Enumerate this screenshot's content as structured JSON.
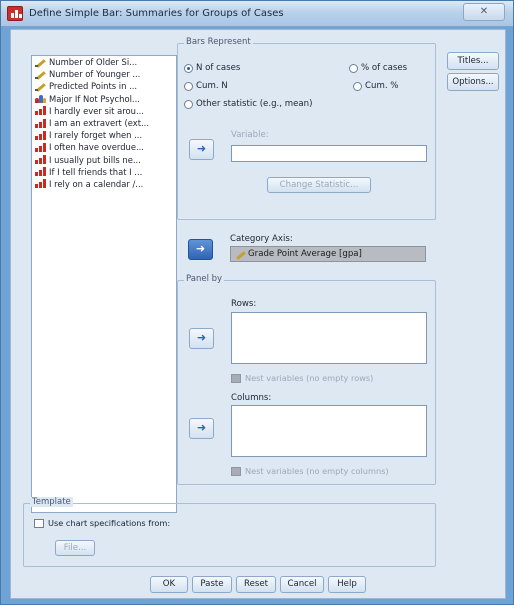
{
  "window": {
    "title": "Define Simple Bar: Summaries for Groups of Cases",
    "close_label": "✕"
  },
  "variables": [
    {
      "label": "Number of Older Si...",
      "icon": "scale-icon"
    },
    {
      "label": "Number of Younger ...",
      "icon": "scale-icon"
    },
    {
      "label": "Predicted Points in ...",
      "icon": "scale-icon"
    },
    {
      "label": "Major If Not Psychol...",
      "icon": "nominal-icon"
    },
    {
      "label": "I hardly ever sit arou...",
      "icon": "ordinal-icon"
    },
    {
      "label": "I am an extravert (ext...",
      "icon": "ordinal-icon"
    },
    {
      "label": "I rarely forget when ...",
      "icon": "ordinal-icon"
    },
    {
      "label": "I often have overdue...",
      "icon": "ordinal-icon"
    },
    {
      "label": "I usually put bills ne...",
      "icon": "ordinal-icon"
    },
    {
      "label": "If I tell friends that I ...",
      "icon": "ordinal-icon"
    },
    {
      "label": "I rely on a calendar /...",
      "icon": "ordinal-icon"
    }
  ],
  "bars_represent": {
    "legend": "Bars Represent",
    "options": {
      "n_cases": "N of cases",
      "pct_cases": "% of cases",
      "cum_n": "Cum. N",
      "cum_pct": "Cum. %",
      "other": "Other statistic (e.g., mean)"
    },
    "selected": "n_cases",
    "variable_label": "Variable:",
    "change_statistic": "Change Statistic..."
  },
  "category_axis": {
    "label": "Category Axis:",
    "value": "Grade Point Average [gpa]"
  },
  "panel_by": {
    "legend": "Panel by",
    "rows_label": "Rows:",
    "nest_rows": "Nest variables (no empty rows)",
    "columns_label": "Columns:",
    "nest_columns": "Nest variables (no empty columns)"
  },
  "template": {
    "legend": "Template",
    "use_chart_spec": "Use chart specifications from:",
    "file_button": "File..."
  },
  "side_buttons": {
    "titles": "Titles...",
    "options": "Options..."
  },
  "bottom_buttons": {
    "ok": "OK",
    "paste": "Paste",
    "reset": "Reset",
    "cancel": "Cancel",
    "help": "Help"
  },
  "colors": {
    "window_blue": "#6fa3d6",
    "client_bg": "#dee8f3",
    "accent_arrow": "#2f63b6"
  }
}
